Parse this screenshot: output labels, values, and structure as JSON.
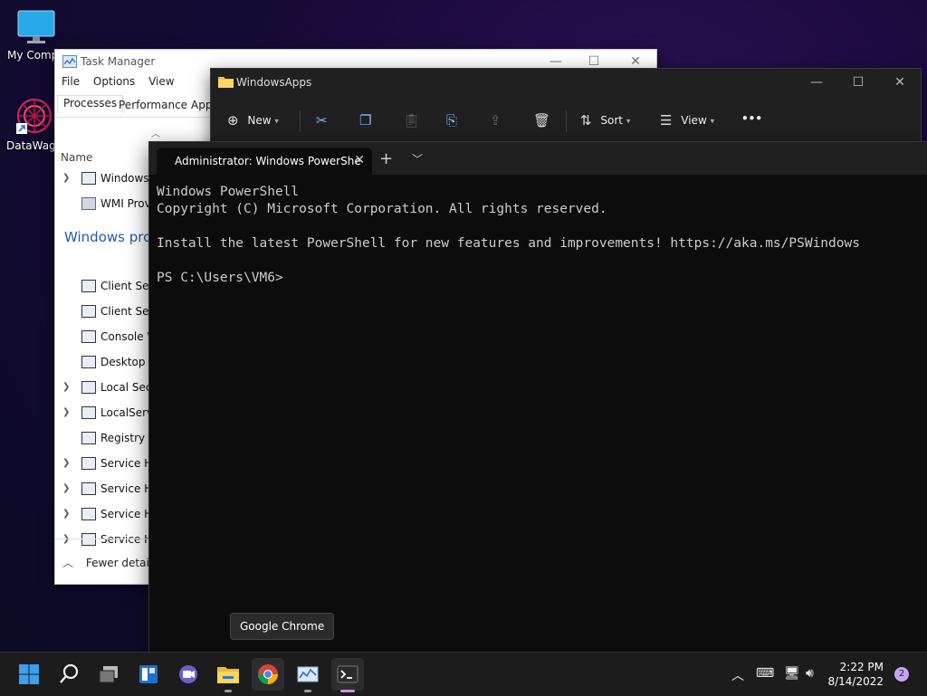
{
  "desktop": {
    "icons": [
      {
        "label": "My Compu"
      },
      {
        "label": "DataWago"
      }
    ]
  },
  "task_manager": {
    "title": "Task Manager",
    "menu": [
      "File",
      "Options",
      "View"
    ],
    "tabs": [
      "Processes",
      "Performance",
      "App"
    ],
    "column_name": "Name",
    "rows_top": [
      {
        "label": "Windows",
        "expandable": true
      },
      {
        "label": "WMI Prov",
        "expandable": false
      }
    ],
    "group_heading": "Windows pro",
    "rows": [
      {
        "label": "Client Serv",
        "expandable": false
      },
      {
        "label": "Client Serv",
        "expandable": false
      },
      {
        "label": "Console W",
        "expandable": false
      },
      {
        "label": "Desktop W",
        "expandable": false
      },
      {
        "label": "Local Secu",
        "expandable": true
      },
      {
        "label": "LocalServi",
        "expandable": true
      },
      {
        "label": "Registry",
        "expandable": false
      },
      {
        "label": "Service Ho",
        "expandable": true
      },
      {
        "label": "Service Ho",
        "expandable": true
      },
      {
        "label": "Service Ho",
        "expandable": true
      },
      {
        "label": "Service Ho",
        "expandable": true
      }
    ],
    "fewer_details": "Fewer details"
  },
  "explorer": {
    "title": "WindowsApps",
    "new_label": "New",
    "sort_label": "Sort",
    "view_label": "View",
    "more_label": "•••"
  },
  "terminal": {
    "tab_title": "Administrator: Windows PowerShe",
    "lines": [
      "Windows PowerShell",
      "Copyright (C) Microsoft Corporation. All rights reserved.",
      "",
      "Install the latest PowerShell for new features and improvements! https://aka.ms/PSWindows",
      "",
      "PS C:\\Users\\VM6>"
    ]
  },
  "tooltip": {
    "text": "Google Chrome"
  },
  "taskbar": {
    "time": "2:22 PM",
    "date": "8/14/2022",
    "notification_count": "2"
  },
  "colors": {
    "accent": "#1d5fa8",
    "terminal_bg": "#0c0c0c",
    "taskbar_bg": "#1c1c1c"
  }
}
